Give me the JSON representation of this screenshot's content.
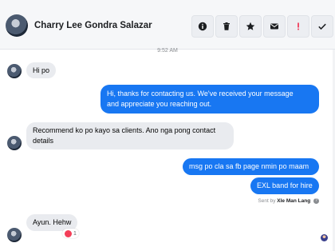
{
  "header": {
    "contact_name": "Charry Lee Gondra Salazar",
    "actions": [
      {
        "name": "info-icon",
        "glyph": "info"
      },
      {
        "name": "trash-icon",
        "glyph": "trash"
      },
      {
        "name": "star-icon",
        "glyph": "star"
      },
      {
        "name": "mail-icon",
        "glyph": "mail"
      },
      {
        "name": "spam-icon",
        "glyph": "!"
      },
      {
        "name": "check-icon",
        "glyph": "check"
      }
    ]
  },
  "conversation": {
    "timestamp": "9:52 AM",
    "messages": [
      {
        "direction": "incoming",
        "text": "Hi po"
      },
      {
        "direction": "outgoing",
        "lines": [
          "Hi, thanks for contacting us. We've received your message",
          "and appreciate you reaching out."
        ]
      },
      {
        "direction": "incoming",
        "lines": [
          "Recommend ko po kayo sa clients. Ano nga pong contact",
          "details"
        ]
      },
      {
        "direction": "outgoing",
        "text": "msg po cla sa fb page nmin po maam"
      },
      {
        "direction": "outgoing",
        "text": "EXL band for hire"
      },
      {
        "direction": "incoming",
        "text": "Ayun. Hehw"
      }
    ],
    "sent_by_prefix": "Sent by",
    "sent_by_name": "Xle Man Lang",
    "help_glyph": "?",
    "reaction_count": "1"
  },
  "colors": {
    "outgoing_bubble": "#1877f2",
    "incoming_bubble": "#e9ebef",
    "spam_accent": "#f02849"
  }
}
